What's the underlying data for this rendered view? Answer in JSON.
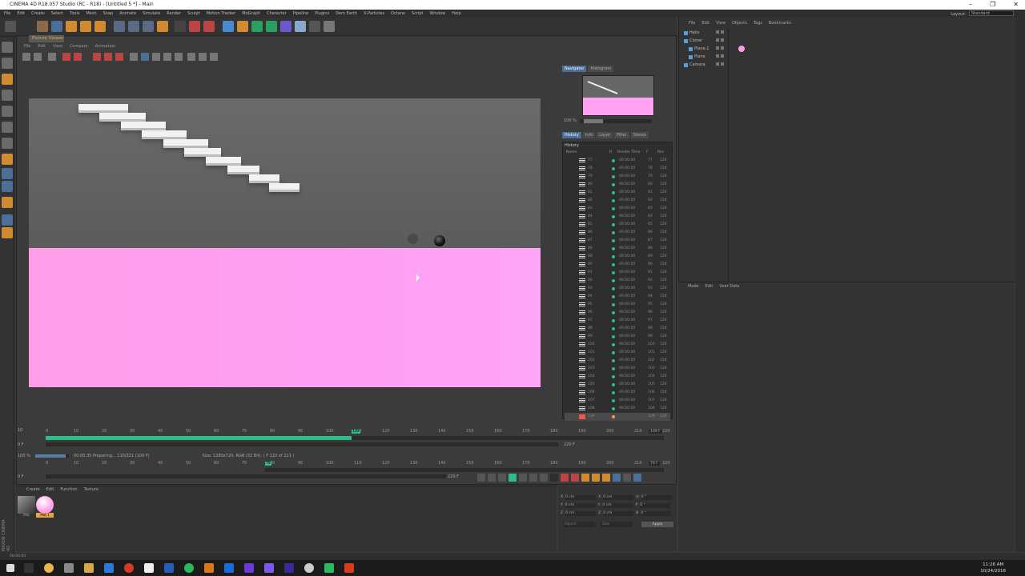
{
  "window": {
    "title": "CINEMA 4D R18.057 Studio (RC - R18) - [Untitled 5 *] - Main"
  },
  "menubar": {
    "items": [
      "File",
      "Edit",
      "Create",
      "Select",
      "Tools",
      "Mesh",
      "Snap",
      "Animate",
      "Simulate",
      "Render",
      "Sculpt",
      "Motion Tracker",
      "MoGraph",
      "Character",
      "Pipeline",
      "Plugins",
      "Dem Earth",
      "X-Particles",
      "Octane",
      "Script",
      "Window",
      "Help"
    ],
    "layout_label": "Layout:",
    "layout_value": "Standard"
  },
  "picture_viewer": {
    "tab": "Picture Viewer",
    "menu": [
      "File",
      "Edit",
      "View",
      "Compare",
      "Animation"
    ],
    "render": {
      "background_color": "#5e5e5e",
      "floor_color": "#ffa0f0"
    }
  },
  "navigator": {
    "tabs": [
      "Navigator",
      "Histogram"
    ],
    "zoom": "100 %"
  },
  "history": {
    "tabs": [
      "History",
      "Info",
      "Layer",
      "Filter",
      "Stereo"
    ],
    "title": "History",
    "columns": [
      "Name",
      "R",
      "Render Time",
      "F",
      "Res"
    ],
    "rows": [
      {
        "name": "77",
        "time": "00:00:00",
        "frame": "77",
        "res": "128"
      },
      {
        "name": "78",
        "time": "00:00:00",
        "frame": "78",
        "res": "128"
      },
      {
        "name": "79",
        "time": "00:00:00",
        "frame": "79",
        "res": "128"
      },
      {
        "name": "80",
        "time": "00:00:00",
        "frame": "80",
        "res": "128"
      },
      {
        "name": "81",
        "time": "00:00:00",
        "frame": "81",
        "res": "128"
      },
      {
        "name": "82",
        "time": "00:00:00",
        "frame": "82",
        "res": "128"
      },
      {
        "name": "83",
        "time": "00:00:00",
        "frame": "83",
        "res": "128"
      },
      {
        "name": "84",
        "time": "00:00:00",
        "frame": "84",
        "res": "128"
      },
      {
        "name": "85",
        "time": "00:00:00",
        "frame": "85",
        "res": "128"
      },
      {
        "name": "86",
        "time": "00:00:00",
        "frame": "86",
        "res": "128"
      },
      {
        "name": "87",
        "time": "00:00:00",
        "frame": "87",
        "res": "128"
      },
      {
        "name": "88",
        "time": "00:00:00",
        "frame": "88",
        "res": "128"
      },
      {
        "name": "89",
        "time": "00:00:00",
        "frame": "89",
        "res": "128"
      },
      {
        "name": "90",
        "time": "00:00:00",
        "frame": "90",
        "res": "128"
      },
      {
        "name": "91",
        "time": "00:00:00",
        "frame": "91",
        "res": "128"
      },
      {
        "name": "92",
        "time": "00:00:00",
        "frame": "92",
        "res": "128"
      },
      {
        "name": "93",
        "time": "00:00:00",
        "frame": "93",
        "res": "128"
      },
      {
        "name": "94",
        "time": "00:00:00",
        "frame": "94",
        "res": "128"
      },
      {
        "name": "95",
        "time": "00:00:00",
        "frame": "95",
        "res": "128"
      },
      {
        "name": "96",
        "time": "00:00:00",
        "frame": "96",
        "res": "128"
      },
      {
        "name": "97",
        "time": "00:00:00",
        "frame": "97",
        "res": "128"
      },
      {
        "name": "98",
        "time": "00:00:00",
        "frame": "98",
        "res": "128"
      },
      {
        "name": "99",
        "time": "00:00:00",
        "frame": "99",
        "res": "128"
      },
      {
        "name": "100",
        "time": "00:00:00",
        "frame": "100",
        "res": "128"
      },
      {
        "name": "101",
        "time": "00:00:00",
        "frame": "101",
        "res": "128"
      },
      {
        "name": "102",
        "time": "00:00:00",
        "frame": "102",
        "res": "128"
      },
      {
        "name": "103",
        "time": "00:00:00",
        "frame": "103",
        "res": "128"
      },
      {
        "name": "104",
        "time": "00:00:00",
        "frame": "104",
        "res": "128"
      },
      {
        "name": "105",
        "time": "00:00:00",
        "frame": "105",
        "res": "128"
      },
      {
        "name": "106",
        "time": "00:00:00",
        "frame": "106",
        "res": "128"
      },
      {
        "name": "107",
        "time": "00:00:00",
        "frame": "107",
        "res": "128"
      },
      {
        "name": "108",
        "time": "00:00:00",
        "frame": "108",
        "res": "128"
      },
      {
        "name": "109",
        "time": "",
        "frame": "109",
        "res": "128",
        "current": true
      }
    ]
  },
  "timeline": {
    "ticks": [
      "0",
      "10",
      "20",
      "30",
      "40",
      "50",
      "60",
      "70",
      "80",
      "90",
      "100",
      "110",
      "120",
      "130",
      "140",
      "150",
      "160",
      "170",
      "180",
      "190",
      "200",
      "210",
      "220"
    ],
    "current_frame_label": "109",
    "current_frame_field": "109 F",
    "start_field": "0 F",
    "end_field": "220 F",
    "progress": 0.495
  },
  "status": {
    "zoom": "100 %",
    "progress_text": "00:00:35 Preparing... 110/221 (109 F)",
    "size_text": "Size: 1280x720, RGB (32 Bit),  ( F 110 of 221 )"
  },
  "timeline2": {
    "ticks": [
      "0",
      "10",
      "20",
      "30",
      "40",
      "50",
      "60",
      "70",
      "80",
      "90",
      "100",
      "110",
      "120",
      "130",
      "140",
      "150",
      "160",
      "170",
      "180",
      "190",
      "200",
      "210",
      "220"
    ],
    "current_frame_label": "79",
    "current_frame_field": "79 F",
    "start_field": "0 F",
    "end_field": "220 F",
    "progress": 0.355
  },
  "materials": {
    "menu": [
      "Create",
      "Edit",
      "Function",
      "Texture"
    ],
    "items": [
      {
        "name": "Mat"
      },
      {
        "name": "Mat.1"
      }
    ]
  },
  "coordinates": {
    "rows": [
      {
        "a": "X",
        "a_val": "0 cm",
        "b": "X",
        "b_val": "0 cm",
        "c": "H",
        "c_val": "0 °"
      },
      {
        "a": "Y",
        "a_val": "0 cm",
        "b": "Y",
        "b_val": "0 cm",
        "c": "P",
        "c_val": "0 °"
      },
      {
        "a": "Z",
        "a_val": "0 cm",
        "b": "Z",
        "b_val": "0 cm",
        "c": "B",
        "c_val": "0 °"
      }
    ],
    "mode1": "Object",
    "mode2": "Size",
    "apply": "Apply"
  },
  "objects": {
    "menu": [
      "File",
      "Edit",
      "View",
      "Objects",
      "Tags",
      "Bookmarks"
    ],
    "items": [
      {
        "name": "Helix",
        "indent": 0
      },
      {
        "name": "Cloner",
        "indent": 0
      },
      {
        "name": "Plane.1",
        "indent": 1
      },
      {
        "name": "Plane",
        "indent": 1
      },
      {
        "name": "Camera",
        "indent": 0
      }
    ]
  },
  "attributes": {
    "menu": [
      "Mode",
      "Edit",
      "User Data"
    ]
  },
  "statusbar": {
    "text": "00:00:00"
  },
  "branding": {
    "text": "MAXON CINEMA 4D"
  },
  "taskbar": {
    "time": "11:26 AM",
    "date": "10/24/2018"
  }
}
